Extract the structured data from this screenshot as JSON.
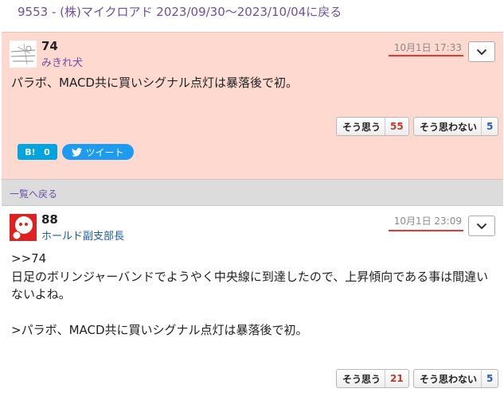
{
  "header": {
    "link": "9553 - (株)マイクロアド 2023/09/30〜2023/10/04に戻る"
  },
  "posts": [
    {
      "number": "74",
      "username": "みきれ犬",
      "time": "10月1日 17:33",
      "body": "パラボ、MACD共に買いシグナル点灯は暴落後で初。",
      "agree_label": "そう思う",
      "agree_count": "55",
      "disagree_label": "そう思わない",
      "disagree_count": "5",
      "hatena_label": "B!",
      "hatena_count": "0",
      "tweet_label": "ツイート"
    },
    {
      "number": "88",
      "username": "ホールド副支部長",
      "time": "10月1日 23:09",
      "body": ">>74\n日足のボリンジャーバンドでようやく中央線に到達したので、上昇傾向である事は間違いないよね。\n\n>パラボ、MACD共に買いシグナル点灯は暴落後で初。",
      "agree_label": "そう思う",
      "agree_count": "21",
      "disagree_label": "そう思わない",
      "disagree_count": "5"
    }
  ],
  "back_link": "一覧へ戻る",
  "colors": {
    "highlight_bg": "#fdd9cf",
    "link": "#6e4fa3",
    "agree": "#c0392b",
    "disagree": "#2d5db3",
    "underline": "#e33333"
  },
  "icons": {
    "menu": "chevron-down-icon",
    "tweet": "twitter-bird-icon",
    "hatena": "hatena-bookmark-icon"
  }
}
